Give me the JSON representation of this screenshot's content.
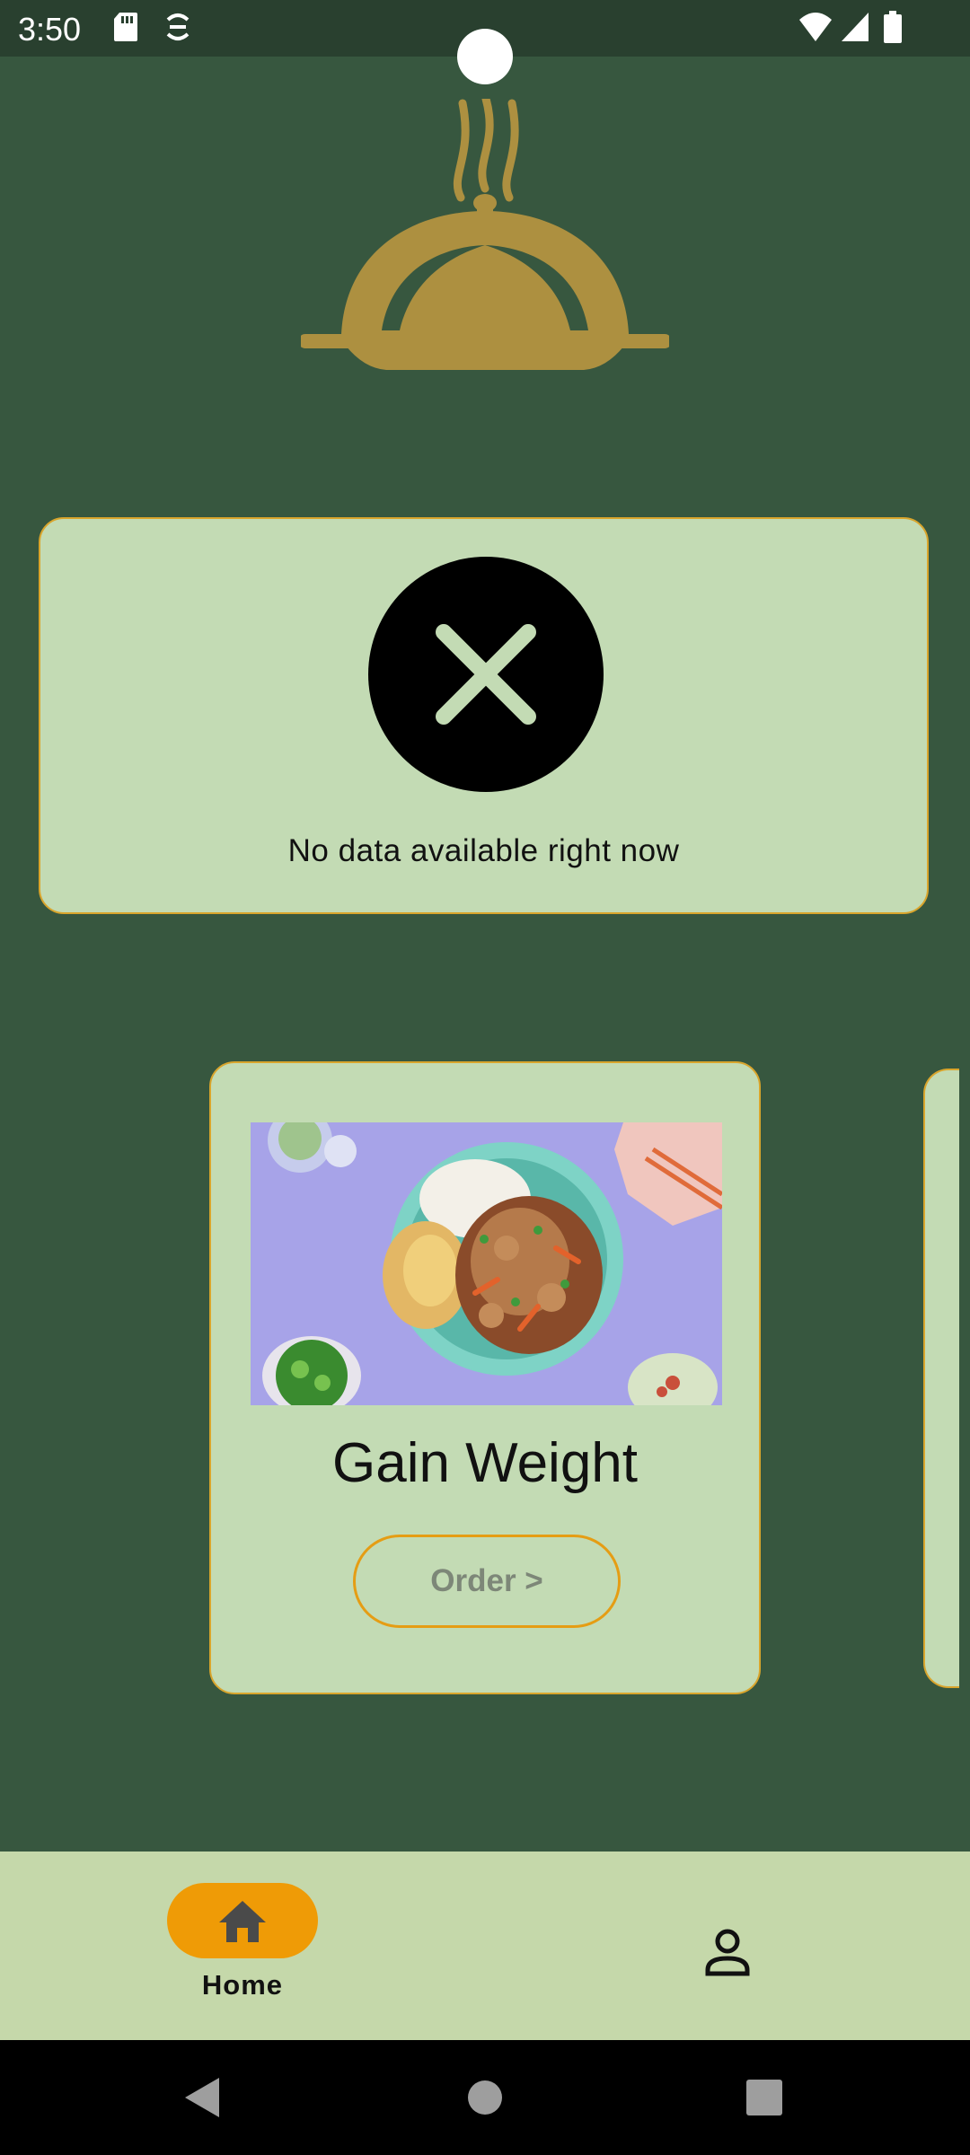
{
  "status_bar": {
    "time": "3:50",
    "left_icons": [
      "sd-card-icon",
      "sync-icon"
    ],
    "right_icons": [
      "wifi-icon",
      "signal-icon",
      "battery-icon"
    ]
  },
  "header": {
    "logo_icon": "cloche-icon"
  },
  "info_card": {
    "icon": "close-icon",
    "message": "No data available right now"
  },
  "plans": [
    {
      "title": "Gain Weight",
      "button_label": "Order >"
    }
  ],
  "bottom_nav": {
    "items": [
      {
        "label": "Home",
        "icon": "home-icon",
        "selected": true
      },
      {
        "label": "",
        "icon": "person-icon",
        "selected": false
      }
    ]
  },
  "system_nav": {
    "buttons": [
      "back-icon",
      "home-circle-icon",
      "recents-icon"
    ]
  },
  "colors": {
    "background": "#37573f",
    "card": "#c3dbb4",
    "accent": "#ef9b06",
    "card_border": "#d9a52c",
    "logo_gold": "#ad9040",
    "nav_bar": "#c5d8aa"
  }
}
